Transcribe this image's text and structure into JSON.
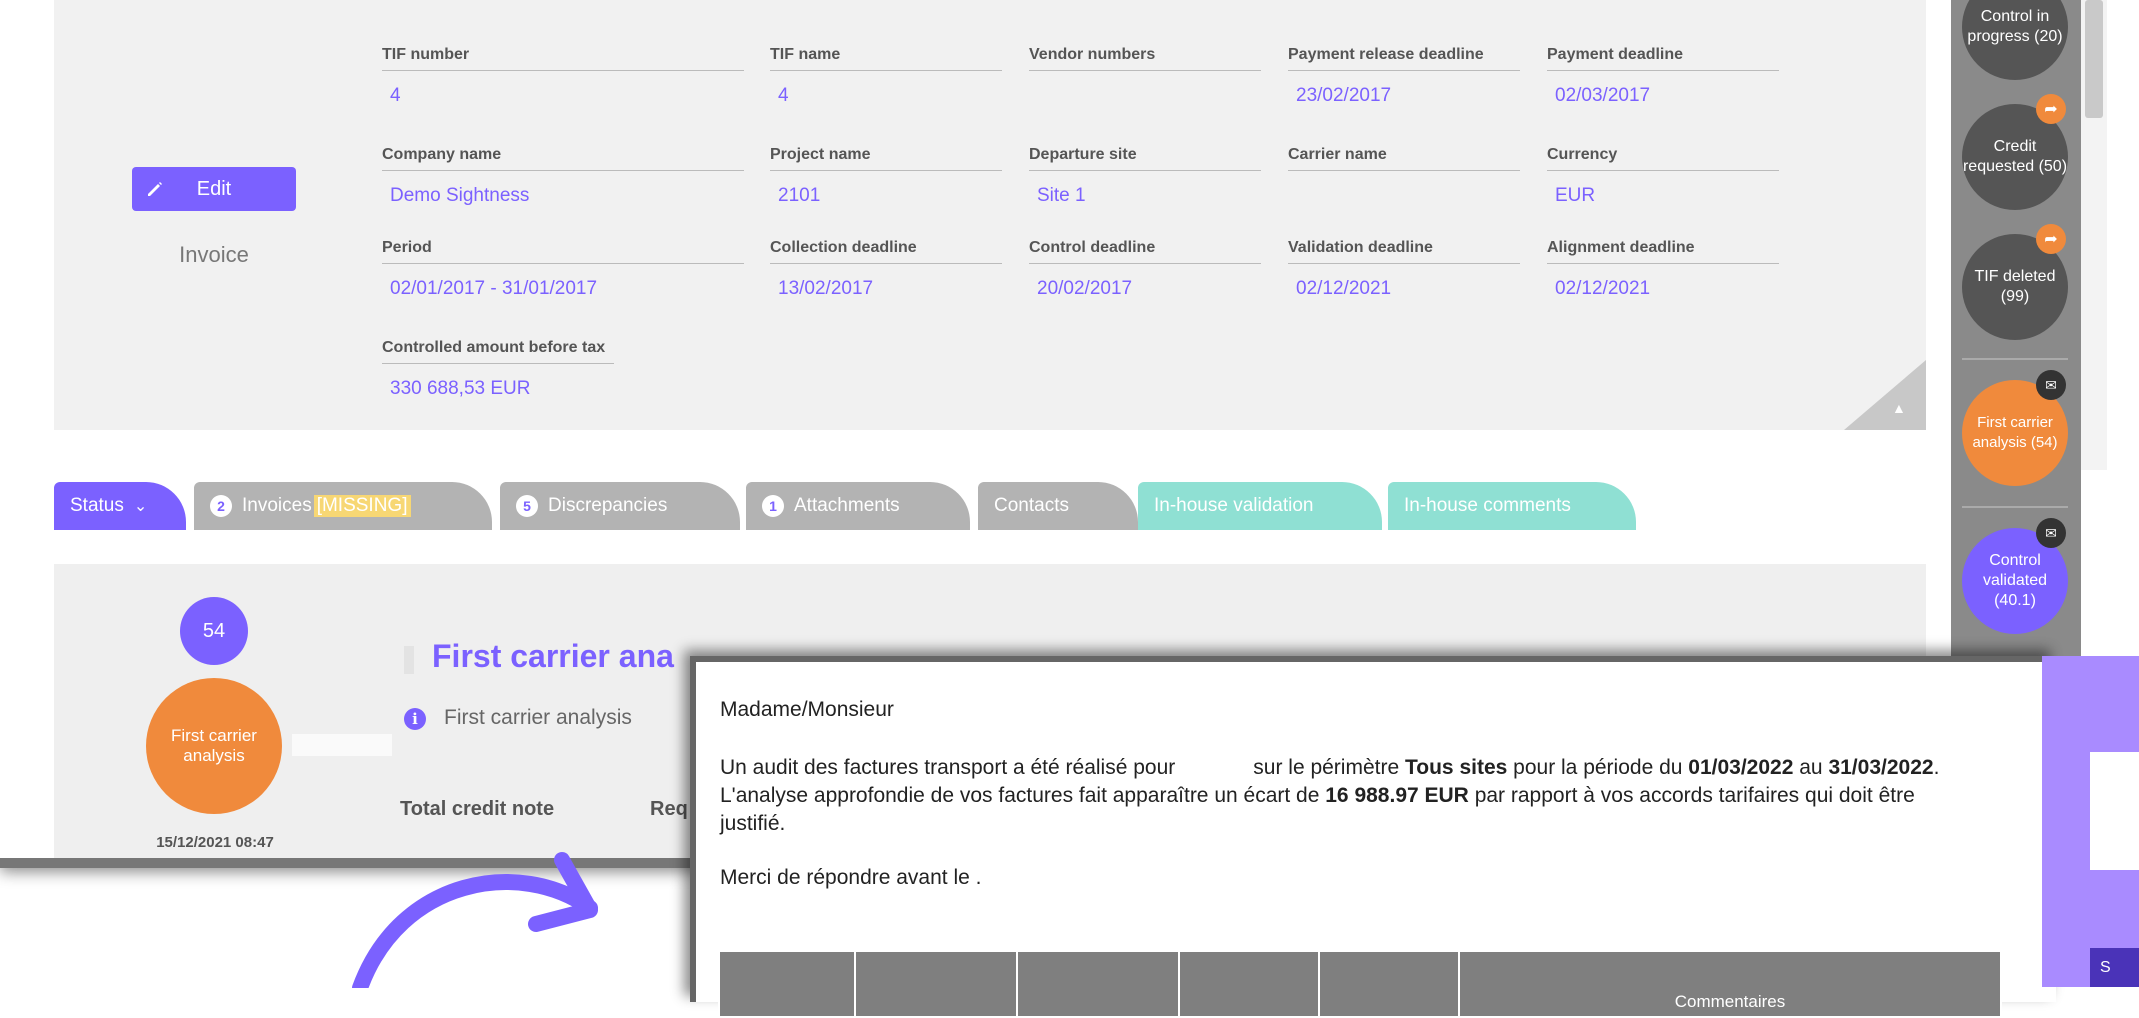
{
  "invoice": {
    "edit_label": "Edit",
    "type_label": "Invoice",
    "fields": [
      {
        "label": "TIF number",
        "value": "4"
      },
      {
        "label": "TIF name",
        "value": "4"
      },
      {
        "label": "Vendor numbers",
        "value": ""
      },
      {
        "label": "Payment release deadline",
        "value": "23/02/2017"
      },
      {
        "label": "Payment deadline",
        "value": "02/03/2017"
      },
      {
        "label": "Company name",
        "value": "Demo Sightness"
      },
      {
        "label": "Project name",
        "value": "2101"
      },
      {
        "label": "Departure site",
        "value": "Site 1"
      },
      {
        "label": "Carrier name",
        "value": ""
      },
      {
        "label": "Currency",
        "value": "EUR"
      },
      {
        "label": "Period",
        "value": "02/01/2017 - 31/01/2017"
      },
      {
        "label": "Collection deadline",
        "value": "13/02/2017"
      },
      {
        "label": "Control deadline",
        "value": "20/02/2017"
      },
      {
        "label": "Validation deadline",
        "value": "02/12/2021"
      },
      {
        "label": "Alignment deadline",
        "value": "02/12/2021"
      },
      {
        "label": "Controlled amount before tax",
        "value": "330 688,53 EUR"
      }
    ]
  },
  "tabs": {
    "status": "Status",
    "invoices_count": "2",
    "invoices": "Invoices",
    "invoices_flag": "[MISSING]",
    "discrepancies_count": "5",
    "discrepancies": "Discrepancies",
    "attachments_count": "1",
    "attachments": "Attachments",
    "contacts": "Contacts",
    "inhouse_validation": "In-house validation",
    "inhouse_comments": "In-house comments"
  },
  "status_panel": {
    "step_number": "54",
    "step_name": "First carrier analysis",
    "timestamp": "15/12/2021 08:47",
    "title": "First carrier ana",
    "subtitle": "First carrier analysis",
    "col1": "Total credit note",
    "col2": "Req"
  },
  "right_column": [
    {
      "label": "Control in progress (20)",
      "color": "#555555"
    },
    {
      "label": "Credit requested (50)",
      "color": "#555555"
    },
    {
      "label": "TIF deleted (99)",
      "color": "#555555"
    },
    {
      "label": "First carrier analysis (54)",
      "color": "#f08a3c"
    },
    {
      "label": "Control validated (40.1)",
      "color": "#7b61ff"
    }
  ],
  "letter": {
    "greeting": "Madame/Monsieur",
    "p1_a": "Un audit des factures transport a été réalisé pour",
    "p1_b": "sur le périmètre",
    "p1_scope": "Tous sites",
    "p1_c": "pour la période du",
    "p1_from": "01/03/2022",
    "p1_d": "au",
    "p1_to": "31/03/2022",
    "p2_a": "L'analyse approfondie de vos factures fait apparaître un écart de",
    "p2_amount": "16 988.97 EUR",
    "p2_b": "par rapport à vos accords tarifaires qui doit être",
    "p2_c": "justifié.",
    "p3": "Merci de répondre avant le .",
    "table_comment_header": "Commentaires"
  },
  "colors": {
    "accent": "#7b61ff",
    "orange": "#f08a3c",
    "teal": "#8fe0d3",
    "grey_tab": "#b0b0b0"
  }
}
